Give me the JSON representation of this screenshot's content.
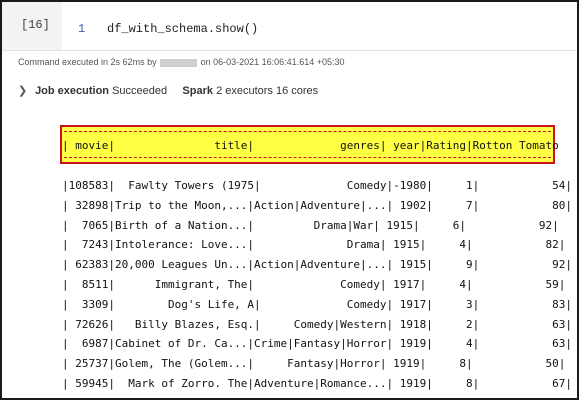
{
  "cell": {
    "label": "[16]",
    "line_number": "1",
    "code": "df_with_schema.show()"
  },
  "execution": {
    "prefix": "Command executed in 2s 62ms by",
    "suffix": "on 06-03-2021 16:06:41.614 +05:30"
  },
  "job": {
    "job_label": "Job execution",
    "job_status": "Succeeded",
    "spark_label": "Spark",
    "spark_info": "2 executors 16 cores"
  },
  "output": {
    "header_line": "| movie|               title|             genres| year|Rating|Rotton Tomato",
    "rows": [
      "|108583|  Fawlty Towers (1975|             Comedy|-1980|     1|           54|",
      "| 32898|Trip to the Moon,...|Action|Adventure|...| 1902|     7|           80|",
      "|  7065|Birth of a Nation...|         Drama|War| 1915|     6|           92|",
      "|  7243|Intolerance: Love...|              Drama| 1915|     4|           82|",
      "| 62383|20,000 Leagues Un...|Action|Adventure|...| 1915|     9|           92|",
      "|  8511|      Immigrant, The|             Comedy| 1917|     4|           59|",
      "|  3309|        Dog's Life, A|             Comedy| 1917|     3|           83|",
      "| 72626|   Billy Blazes, Esq.|     Comedy|Western| 1918|     2|           63|",
      "|  6987|Cabinet of Dr. Ca...|Crime|Fantasy|Horror| 1919|     4|           63|",
      "| 25737|Golem, The (Golem...|     Fantasy|Horror| 1919|     8|           50|",
      "| 59945|  Mark of Zorro. The|Adventure|Romance...| 1919|     8|           67|"
    ]
  },
  "colors": {
    "highlight": "#ffff44",
    "highlight_border": "#c8141e",
    "line_number": "#3a5fb0"
  }
}
